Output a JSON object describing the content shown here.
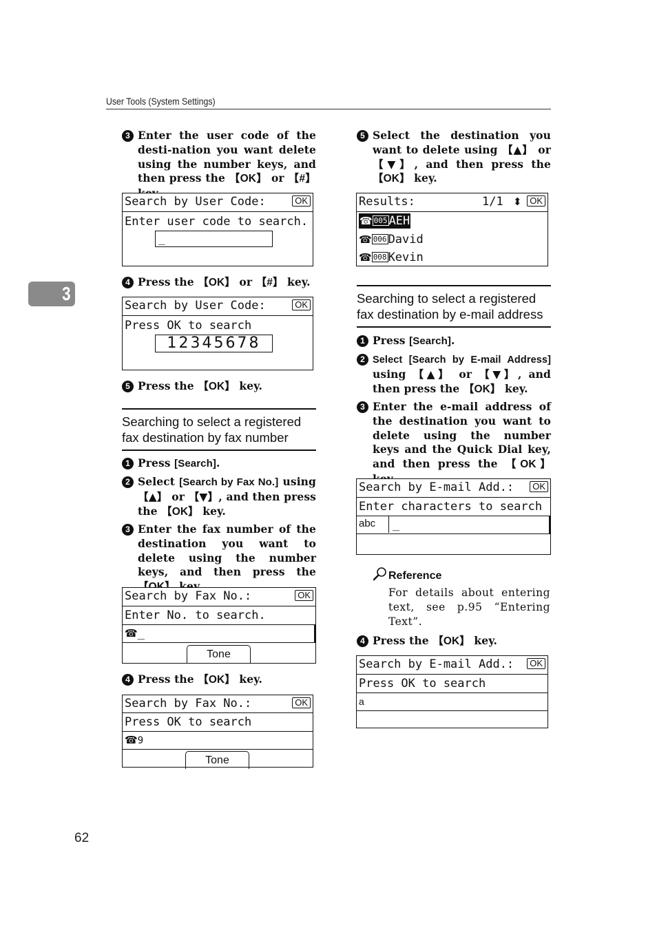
{
  "header": {
    "running_title": "User Tools (System Settings)"
  },
  "chapter_tab": "3",
  "page_number": "62",
  "left_column": {
    "step3_user_code": {
      "num": "3",
      "text_before": "Enter the user code of the desti-nation you want delete using the number keys, and then press the ",
      "key_ok": "OK",
      "text_or": " or ",
      "key_hash": "#",
      "text_after": " key."
    },
    "lcd_user_code_entry": {
      "title": "Search by User Code:",
      "ok": "OK",
      "prompt": "Enter user code to search.",
      "input_value": "_"
    },
    "step4_user_code": {
      "num": "4",
      "text_before": "Press the ",
      "key_ok": "OK",
      "text_or": " or ",
      "key_hash": "#",
      "text_after": " key."
    },
    "lcd_user_code_ready": {
      "title": "Search by User Code:",
      "ok": "OK",
      "prompt": "Press OK to search",
      "input_value": "12345678"
    },
    "step5_user_code": {
      "num": "5",
      "text_before": "Press the ",
      "key_ok": "OK",
      "text_after": " key."
    },
    "section_fax_number": {
      "title_line1": "Searching to select a registered",
      "title_line2": "fax destination by fax number"
    },
    "fax_step1": {
      "num": "1",
      "text_before": "Press ",
      "ui_label": "[Search]",
      "text_after": "."
    },
    "fax_step2": {
      "num": "2",
      "text_before": "Select ",
      "ui_label": "[Search by Fax No.]",
      "text_mid": " using ",
      "key_up": "▲",
      "text_or": " or ",
      "key_down": "▼",
      "text_after": ", and then press the ",
      "key_ok": "OK",
      "text_end": " key."
    },
    "fax_step3": {
      "num": "3",
      "text_before": "Enter the fax number of the destination you want to delete using the number keys, and then press the ",
      "key_ok": "OK",
      "text_after": " key."
    },
    "lcd_fax_entry": {
      "title": "Search by Fax No.:",
      "ok": "OK",
      "prompt": "Enter No. to search.",
      "input_value": "_",
      "soft_key": "Tone"
    },
    "fax_step4": {
      "num": "4",
      "text_before": "Press the ",
      "key_ok": "OK",
      "text_after": " key."
    },
    "lcd_fax_ready": {
      "title": "Search by Fax No.:",
      "ok": "OK",
      "prompt": "Press OK to search",
      "input_value": "9",
      "soft_key": "Tone"
    }
  },
  "right_column": {
    "step5_select": {
      "num": "5",
      "text_before": "Select the destination you want to delete using ",
      "key_up": "▲",
      "text_or": " or ",
      "key_down": "▼",
      "text_after": ", and then press the ",
      "key_ok": "OK",
      "text_end": " key."
    },
    "lcd_results": {
      "title": "Results:",
      "page": "1/1",
      "ok": "OK",
      "items": [
        {
          "code": "005",
          "name": "AEH",
          "selected": true
        },
        {
          "code": "006",
          "name": "David",
          "selected": false
        },
        {
          "code": "008",
          "name": "Kevin",
          "selected": false
        }
      ]
    },
    "section_email": {
      "title_line1": "Searching to select a registered",
      "title_line2": "fax destination by e-mail address"
    },
    "email_step1": {
      "num": "1",
      "text_before": "Press ",
      "ui_label": "[Search]",
      "text_after": "."
    },
    "email_step2": {
      "num": "2",
      "text_before": "Select ",
      "ui_label": "[Search by E-mail Address]",
      "text_mid": " using ",
      "key_up": "▲",
      "text_or": " or ",
      "key_down": "▼",
      "text_after": ", and then press the ",
      "key_ok": "OK",
      "text_end": " key."
    },
    "email_step3": {
      "num": "3",
      "text_before": "Enter the e-mail address of the destination you want to delete using the number keys and the Quick Dial key, and then press the ",
      "key_ok": "OK",
      "text_after": " key."
    },
    "lcd_email_entry": {
      "title": "Search by E-mail Add.:",
      "ok": "OK",
      "prompt": "Enter characters to search",
      "mode": "abc",
      "input_value": "_"
    },
    "reference": {
      "title": "Reference",
      "body": "For details about entering text, see p.95 “Entering Text”."
    },
    "email_step4": {
      "num": "4",
      "text_before": "Press the ",
      "key_ok": "OK",
      "text_after": " key."
    },
    "lcd_email_ready": {
      "title": "Search by E-mail Add.:",
      "ok": "OK",
      "prompt": "Press OK to search",
      "input_value": "a"
    }
  }
}
